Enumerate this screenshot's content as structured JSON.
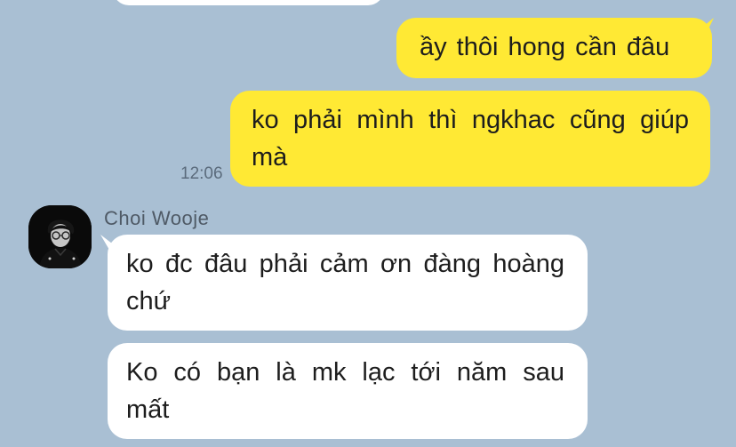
{
  "colors": {
    "background": "#a9bfd3",
    "outgoing_bubble": "#ffe934",
    "incoming_bubble": "#ffffff",
    "timestamp": "#5b6b7c"
  },
  "chat": {
    "messages_outgoing": [
      {
        "text": "ầy thôi hong cần đâu"
      },
      {
        "text": "ko phải mình thì ngkhac cũng giúp mà",
        "time": "12:06"
      }
    ],
    "contact": {
      "name": "Choi Wooje",
      "avatar_icon": "profile-photo-icon"
    },
    "messages_incoming": [
      {
        "text": "ko đc đâu phải cảm ơn đàng hoàng chứ"
      },
      {
        "text": "Ko có bạn là mk lạc tới năm sau mất"
      }
    ]
  }
}
